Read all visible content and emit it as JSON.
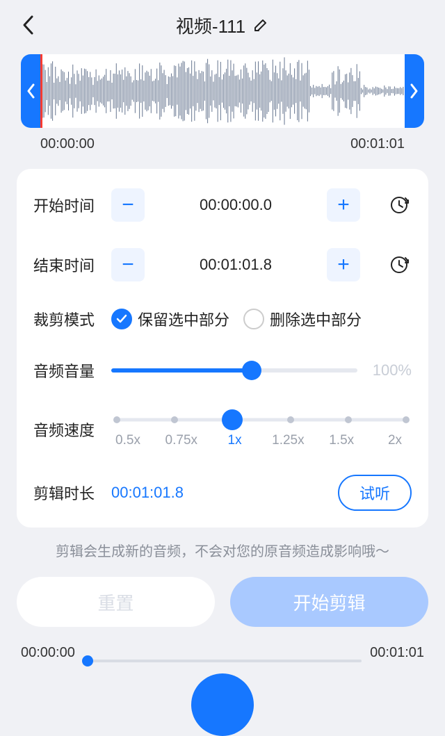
{
  "header": {
    "title": "视频-111"
  },
  "waveform": {
    "start_time": "00:00:00",
    "end_time": "00:01:01"
  },
  "start": {
    "label": "开始时间",
    "value": "00:00:00.0"
  },
  "end": {
    "label": "结束时间",
    "value": "00:01:01.8"
  },
  "clip_mode": {
    "label": "裁剪模式",
    "keep": "保留选中部分",
    "remove": "删除选中部分",
    "selected": "keep"
  },
  "volume": {
    "label": "音频音量",
    "percent_text": "100%",
    "fill_pct": 57
  },
  "speed": {
    "label": "音频速度",
    "options": [
      "0.5x",
      "0.75x",
      "1x",
      "1.25x",
      "1.5x",
      "2x"
    ],
    "selected_index": 2
  },
  "duration": {
    "label": "剪辑时长",
    "value": "00:01:01.8",
    "preview": "试听"
  },
  "hint": "剪辑会生成新的音频，不会对您的原音频造成影响哦～",
  "actions": {
    "reset": "重置",
    "start": "开始剪辑"
  },
  "playbar": {
    "current": "00:00:00",
    "total": "00:01:01"
  }
}
